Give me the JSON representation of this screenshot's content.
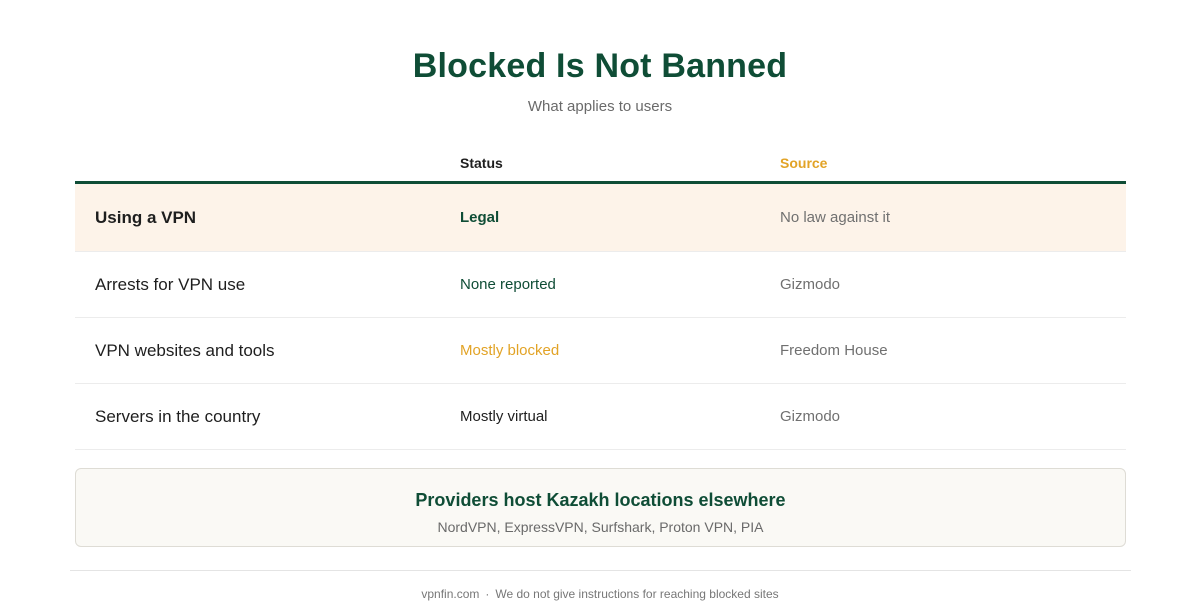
{
  "header": {
    "title": "Blocked Is Not Banned",
    "subtitle": "What applies to users"
  },
  "table": {
    "columns": {
      "status": "Status",
      "source": "Source"
    },
    "rows": [
      {
        "label": "Using a VPN",
        "status": "Legal",
        "source": "No law against it"
      },
      {
        "label": "Arrests for VPN use",
        "status": "None reported",
        "source": "Gizmodo"
      },
      {
        "label": "VPN websites and tools",
        "status": "Mostly blocked",
        "source": "Freedom House"
      },
      {
        "label": "Servers in the country",
        "status": "Mostly virtual",
        "source": "Gizmodo"
      }
    ]
  },
  "callout": {
    "title": "Providers host Kazakh locations elsewhere",
    "text": "NordVPN, ExpressVPN, Surfshark, Proton VPN, PIA"
  },
  "footer": {
    "site": "vpnfin.com",
    "separator": "·",
    "note": "We do not give instructions for reaching blocked sites"
  },
  "colors": {
    "brand_green": "#0f4d36",
    "accent_amber": "#e2a326",
    "highlight_row": "#fdf3e9",
    "callout_bg": "#faf9f5"
  }
}
